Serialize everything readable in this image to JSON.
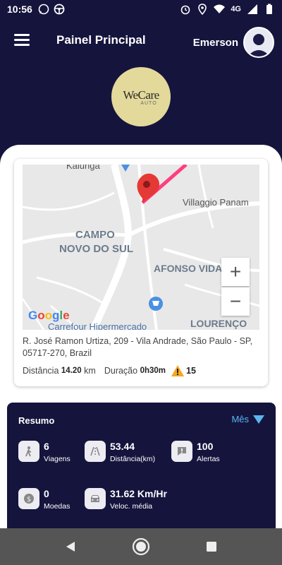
{
  "status_bar": {
    "time": "10:56",
    "network": "4G"
  },
  "header": {
    "title": "Painel Principal",
    "username": "Emerson"
  },
  "logo": {
    "brand": "WeCare",
    "sub": "AUTO"
  },
  "map": {
    "labels": {
      "kalunga": "Kalunga",
      "villaggio": "Villaggio Panam",
      "campo": "CAMPO",
      "novo_do_sul": "NOVO DO SUL",
      "afonso": "AFONSO VIDAL",
      "carrefour": "Carrefour Hipermercado",
      "lourenco": "LOURENÇO"
    },
    "zoom_in": "+",
    "zoom_out": "−",
    "attribution": "Google",
    "route_color": "#ff3d7f",
    "pin_color": "#e53935"
  },
  "trip": {
    "address": "R. José Ramon Urtiza, 209 - Vila Andrade, São Paulo - SP, 05717-270, Brazil",
    "distance_label": "Distância",
    "distance_value": "14.20",
    "distance_unit": "km",
    "duration_label": "Duração",
    "duration_value": "0h30m",
    "alerts": "15"
  },
  "summary": {
    "title": "Resumo",
    "period": "Mês",
    "stats": [
      {
        "value": "6",
        "label": "Viagens",
        "icon": "person-walking-icon"
      },
      {
        "value": "53.44",
        "label": "Distância(km)",
        "icon": "road-icon"
      },
      {
        "value": "100",
        "label": "Alertas",
        "icon": "alert-message-icon"
      },
      {
        "value": "0",
        "label": "Moedas",
        "icon": "coin-icon"
      },
      {
        "value": "31.62 Km/Hr",
        "label": "Veloc. média",
        "icon": "car-icon"
      }
    ]
  },
  "colors": {
    "background": "#15143d",
    "accent": "#5ab7ee",
    "logo_bg": "#e3d99a",
    "warning": "#f5a623"
  }
}
